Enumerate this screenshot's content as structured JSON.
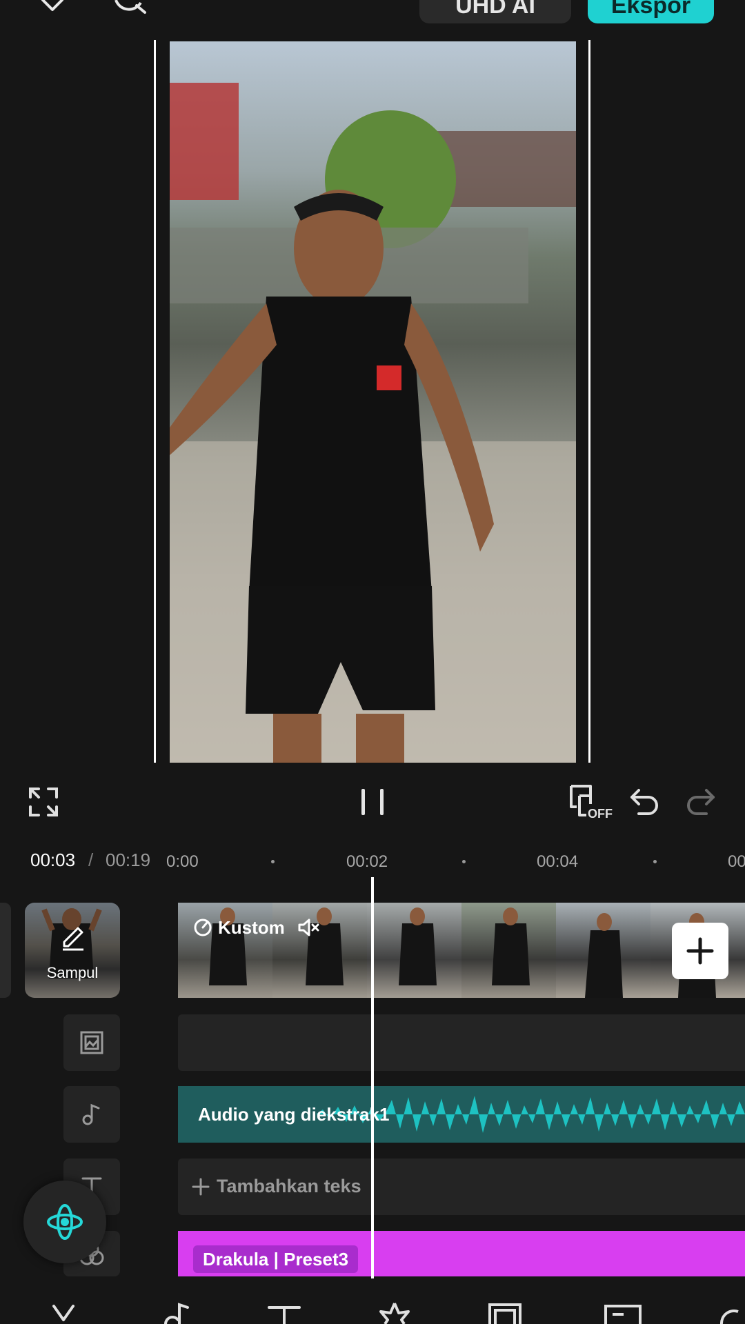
{
  "topbar": {
    "close_icon": "close-icon",
    "search_icon": "search-icon",
    "resolution_label": "UHD AI",
    "export_label": "Ekspor"
  },
  "controls": {
    "fullscreen_icon": "fullscreen-icon",
    "pause_icon": "pause-icon",
    "keyframe_icon": "keyframe-off-icon",
    "keyframe_badge": "OFF",
    "undo_icon": "undo-icon",
    "redo_icon": "redo-icon"
  },
  "timeline": {
    "current_time": "00:03",
    "separator": "/",
    "total_time": "00:19",
    "ruler": [
      "0:00",
      "00:02",
      "00:04",
      "00"
    ],
    "cover_label": "Sampul",
    "clip_speed_label": "Kustom",
    "audio_label": "Audio yang diekstrak1",
    "text_track_label": "Tambahkan teks",
    "effect_label": "Drakula | Preset3"
  },
  "colors": {
    "accent": "#1fd1d1",
    "effect_track": "#d83ef0",
    "audio_wave": "#1ec2c2"
  }
}
